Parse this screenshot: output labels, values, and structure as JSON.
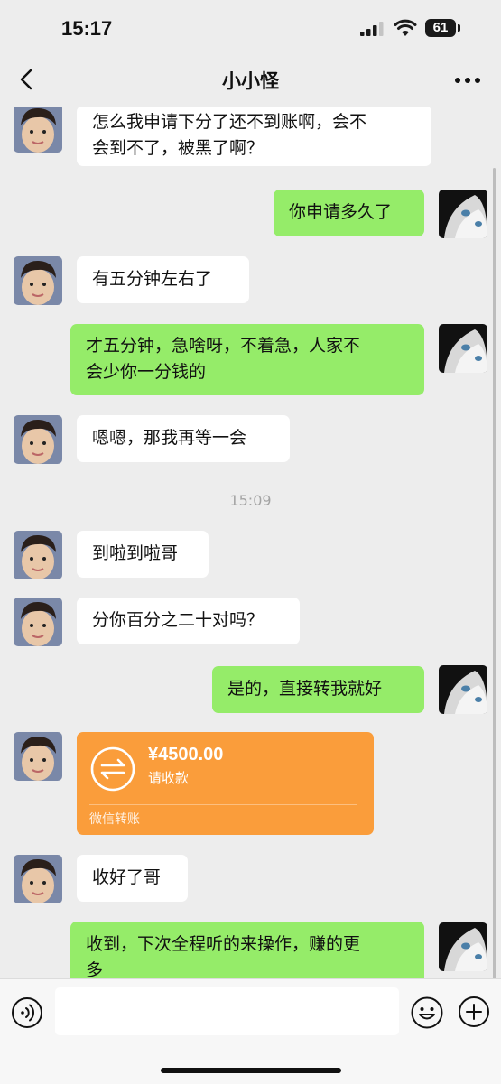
{
  "status_bar": {
    "time": "15:17",
    "battery": "61"
  },
  "header": {
    "title": "小小怪"
  },
  "messages": [
    {
      "side": "in",
      "lines": [
        "怎么我申请下分了还不到账啊，会不",
        "会到不了，被黑了啊？"
      ]
    },
    {
      "side": "out",
      "lines": [
        "你申请多久了"
      ]
    },
    {
      "side": "in",
      "lines": [
        "有五分钟左右了"
      ]
    },
    {
      "side": "out",
      "lines": [
        "才五分钟，急啥呀，不着急，人家不",
        "会少你一分钱的"
      ]
    },
    {
      "side": "in",
      "lines": [
        "嗯嗯，那我再等一会"
      ]
    },
    {
      "side": "in",
      "lines": [
        "到啦到啦哥"
      ]
    },
    {
      "side": "in",
      "lines": [
        "分你百分之二十对吗？"
      ]
    },
    {
      "side": "out",
      "lines": [
        "是的，直接转我就好"
      ]
    },
    {
      "side": "in",
      "lines": [
        "收好了哥"
      ]
    },
    {
      "side": "out",
      "lines": [
        "收到，下次全程听的来操作，赚的更",
        "多"
      ]
    }
  ],
  "timestamp": "15:09",
  "transfer": {
    "amount": "¥4500.00",
    "status": "请收款",
    "source": "微信转账"
  },
  "colors": {
    "outgoing_bubble": "#95ec69",
    "incoming_bubble": "#ffffff",
    "transfer_card": "#fa9d3b",
    "background": "#ededed"
  },
  "icons": {
    "back": "chevron-left-icon",
    "more": "more-dots-icon",
    "voice": "voice-icon",
    "emoji": "emoji-icon",
    "plus": "plus-icon"
  }
}
